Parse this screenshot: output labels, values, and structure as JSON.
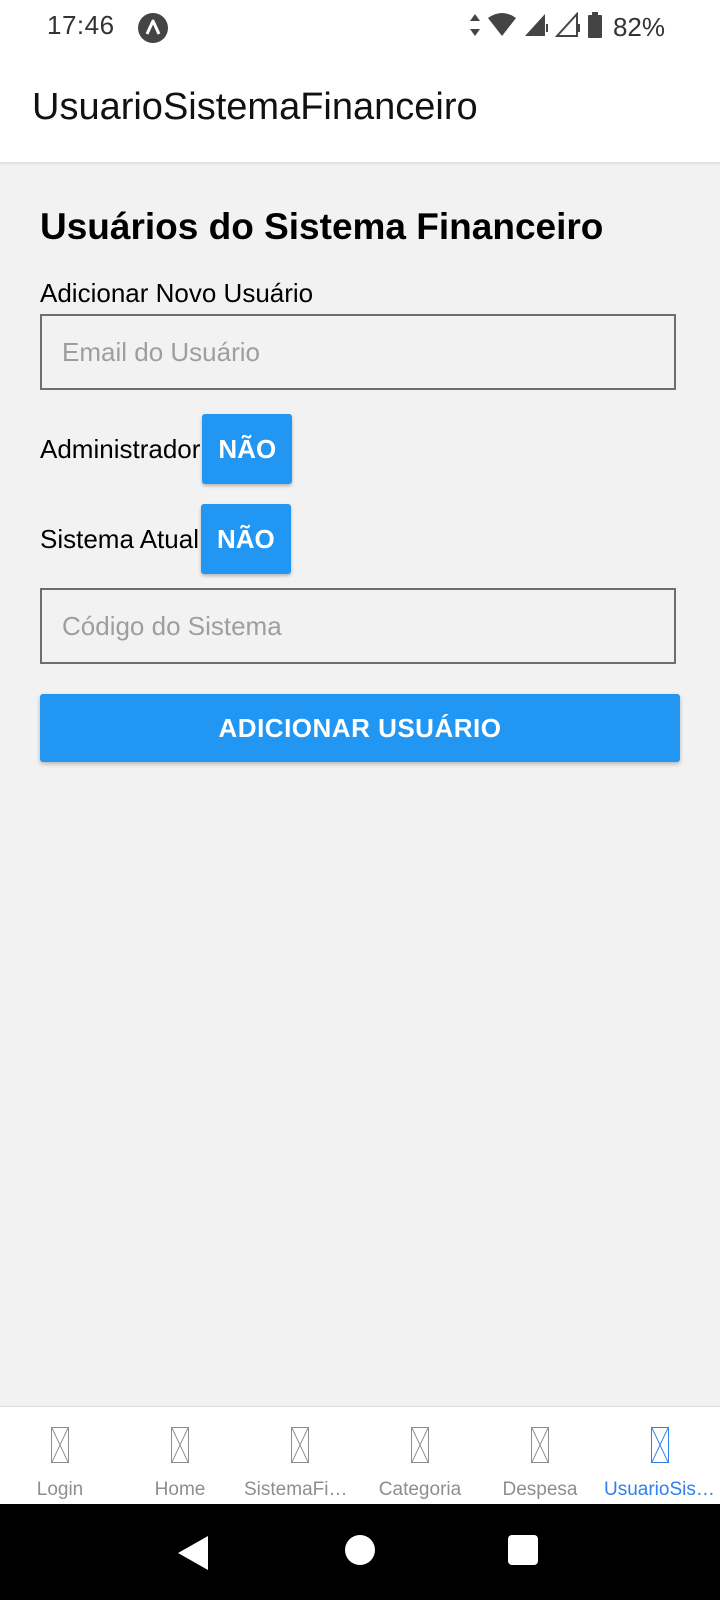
{
  "status_bar": {
    "time": "17:46",
    "battery": "82%",
    "icons": [
      "android-app-icon",
      "data-arrows-icon",
      "wifi-icon",
      "signal-icon",
      "signal-empty-icon",
      "battery-icon"
    ]
  },
  "app_bar": {
    "title": "UsuarioSistemaFinanceiro"
  },
  "form": {
    "title": "Usuários do Sistema Financeiro",
    "section_label": "Adicionar Novo Usuário",
    "email_placeholder": "Email do Usuário",
    "admin_label": "Administrador",
    "admin_value": "NÃO",
    "sistema_label": "Sistema Atual",
    "sistema_value": "NÃO",
    "code_placeholder": "Código do Sistema",
    "submit_label": "ADICIONAR USUÁRIO"
  },
  "tabs": [
    {
      "label": "Login",
      "active": false
    },
    {
      "label": "Home",
      "active": false
    },
    {
      "label": "SistemaFinanceiro",
      "active": false
    },
    {
      "label": "Categoria",
      "active": false
    },
    {
      "label": "Despesa",
      "active": false
    },
    {
      "label": "UsuarioSistemaFinanceiro",
      "active": true
    }
  ],
  "colors": {
    "primary": "#2196f3",
    "active_tab": "#2f80ed",
    "inactive_tab": "#8e8e8e",
    "background": "#f2f2f2"
  }
}
